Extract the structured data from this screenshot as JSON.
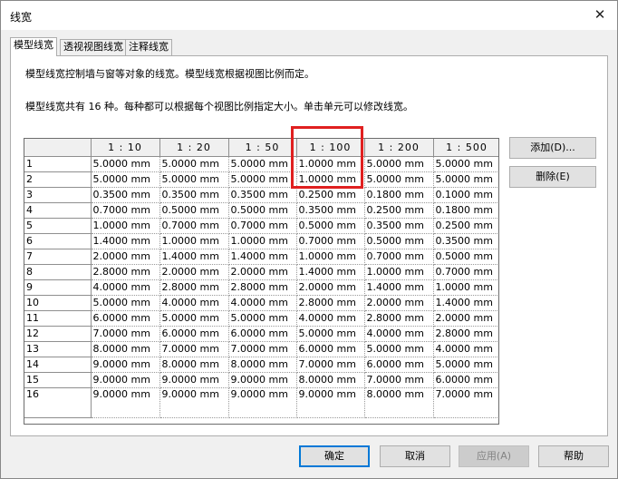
{
  "window": {
    "title": "线宽",
    "close_glyph": "✕"
  },
  "tabs": [
    {
      "label": "模型线宽",
      "active": true
    },
    {
      "label": "透视视图线宽",
      "active": false
    },
    {
      "label": "注释线宽",
      "active": false
    }
  ],
  "description": {
    "line1": "模型线宽控制墙与窗等对象的线宽。模型线宽根据视图比例而定。",
    "line2": "模型线宽共有 16 种。每种都可以根据每个视图比例指定大小。单击单元可以修改线宽。"
  },
  "table": {
    "columns": [
      "1 : 10",
      "1 : 20",
      "1 : 50",
      "1 : 100",
      "1 : 200",
      "1 : 500"
    ],
    "rows": [
      {
        "id": "1",
        "cells": [
          "5.0000 mm",
          "5.0000 mm",
          "5.0000 mm",
          "1.0000 mm",
          "5.0000 mm",
          "5.0000 mm"
        ]
      },
      {
        "id": "2",
        "cells": [
          "5.0000 mm",
          "5.0000 mm",
          "5.0000 mm",
          "1.0000 mm",
          "5.0000 mm",
          "5.0000 mm"
        ]
      },
      {
        "id": "3",
        "cells": [
          "0.3500 mm",
          "0.3500 mm",
          "0.3500 mm",
          "0.2500 mm",
          "0.1800 mm",
          "0.1000 mm"
        ]
      },
      {
        "id": "4",
        "cells": [
          "0.7000 mm",
          "0.5000 mm",
          "0.5000 mm",
          "0.3500 mm",
          "0.2500 mm",
          "0.1800 mm"
        ]
      },
      {
        "id": "5",
        "cells": [
          "1.0000 mm",
          "0.7000 mm",
          "0.7000 mm",
          "0.5000 mm",
          "0.3500 mm",
          "0.2500 mm"
        ]
      },
      {
        "id": "6",
        "cells": [
          "1.4000 mm",
          "1.0000 mm",
          "1.0000 mm",
          "0.7000 mm",
          "0.5000 mm",
          "0.3500 mm"
        ]
      },
      {
        "id": "7",
        "cells": [
          "2.0000 mm",
          "1.4000 mm",
          "1.4000 mm",
          "1.0000 mm",
          "0.7000 mm",
          "0.5000 mm"
        ]
      },
      {
        "id": "8",
        "cells": [
          "2.8000 mm",
          "2.0000 mm",
          "2.0000 mm",
          "1.4000 mm",
          "1.0000 mm",
          "0.7000 mm"
        ]
      },
      {
        "id": "9",
        "cells": [
          "4.0000 mm",
          "2.8000 mm",
          "2.8000 mm",
          "2.0000 mm",
          "1.4000 mm",
          "1.0000 mm"
        ]
      },
      {
        "id": "10",
        "cells": [
          "5.0000 mm",
          "4.0000 mm",
          "4.0000 mm",
          "2.8000 mm",
          "2.0000 mm",
          "1.4000 mm"
        ]
      },
      {
        "id": "11",
        "cells": [
          "6.0000 mm",
          "5.0000 mm",
          "5.0000 mm",
          "4.0000 mm",
          "2.8000 mm",
          "2.0000 mm"
        ]
      },
      {
        "id": "12",
        "cells": [
          "7.0000 mm",
          "6.0000 mm",
          "6.0000 mm",
          "5.0000 mm",
          "4.0000 mm",
          "2.8000 mm"
        ]
      },
      {
        "id": "13",
        "cells": [
          "8.0000 mm",
          "7.0000 mm",
          "7.0000 mm",
          "6.0000 mm",
          "5.0000 mm",
          "4.0000 mm"
        ]
      },
      {
        "id": "14",
        "cells": [
          "9.0000 mm",
          "8.0000 mm",
          "8.0000 mm",
          "7.0000 mm",
          "6.0000 mm",
          "5.0000 mm"
        ]
      },
      {
        "id": "15",
        "cells": [
          "9.0000 mm",
          "9.0000 mm",
          "9.0000 mm",
          "8.0000 mm",
          "7.0000 mm",
          "6.0000 mm"
        ]
      },
      {
        "id": "16",
        "cells": [
          "9.0000 mm",
          "9.0000 mm",
          "9.0000 mm",
          "9.0000 mm",
          "8.0000 mm",
          "7.0000 mm"
        ]
      }
    ]
  },
  "side_buttons": {
    "add": "添加(D)...",
    "delete": "删除(E)"
  },
  "footer": {
    "ok": "确定",
    "cancel": "取消",
    "apply": "应用(A)",
    "help": "帮助"
  },
  "colors": {
    "highlight": "#e02020",
    "default_button_border": "#0078d7"
  }
}
